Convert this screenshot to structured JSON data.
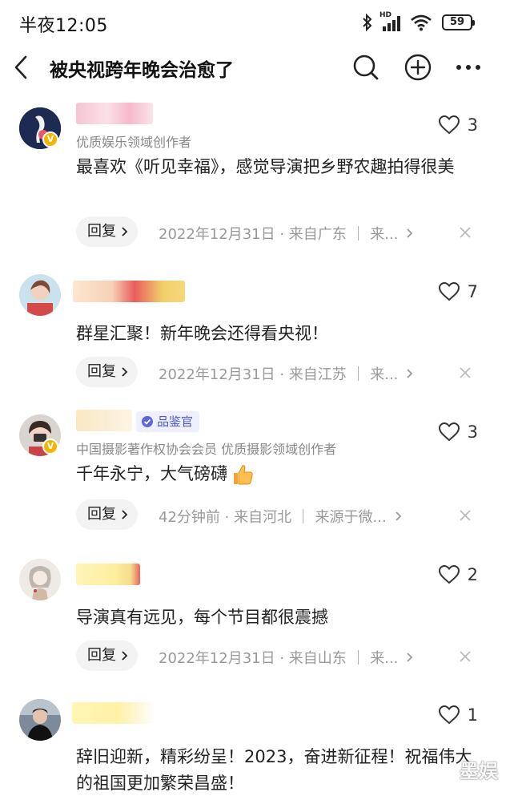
{
  "status_bar": {
    "time": "半夜12:05",
    "battery": "59",
    "network": "HD"
  },
  "header": {
    "title": "被央视跨年晚会治愈了"
  },
  "comments": [
    {
      "subtitle": "优质娱乐领域创作者",
      "text": "最喜欢《听见幸福》，感觉导演把乡野农趣拍得很美",
      "likes": "3",
      "reply_label": "回复",
      "meta": "2022年12月31日 · 来自广东 ｜ 来..."
    },
    {
      "subtitle": "",
      "text": "群星汇聚！新年晚会还得看央视！",
      "likes": "7",
      "reply_label": "回复",
      "meta": "2022年12月31日 · 来自江苏 ｜ 来..."
    },
    {
      "badge": "品鉴官",
      "subtitle": "中国摄影著作权协会会员 优质摄影领域创作者",
      "text": "千年永宁，大气磅礴",
      "likes": "3",
      "reply_label": "回复",
      "meta": "42分钟前 · 来自河北 ｜ 来源于微..."
    },
    {
      "subtitle": "",
      "text": "导演真有远见，每个节目都很震撼",
      "likes": "2",
      "reply_label": "回复",
      "meta": "2022年12月31日 · 来自山东 ｜ 来..."
    },
    {
      "subtitle": "",
      "text": "辞旧迎新，精彩纷呈！2023，奋进新征程！祝福伟大的祖国更加繁荣昌盛！",
      "likes": "1",
      "reply_label": "",
      "meta": ""
    }
  ],
  "watermark": "墨娱",
  "colors": {
    "like_icon": "#333333",
    "reply_bg": "#f3f3f3",
    "meta_text": "#999999",
    "v_badge": "#f5b400",
    "badge_text": "#4b56d8"
  },
  "icons": [
    "back-icon",
    "search-icon",
    "add-icon",
    "more-icon",
    "heart-icon",
    "chevron-right-icon",
    "close-icon",
    "thumbs-up-emoji"
  ]
}
